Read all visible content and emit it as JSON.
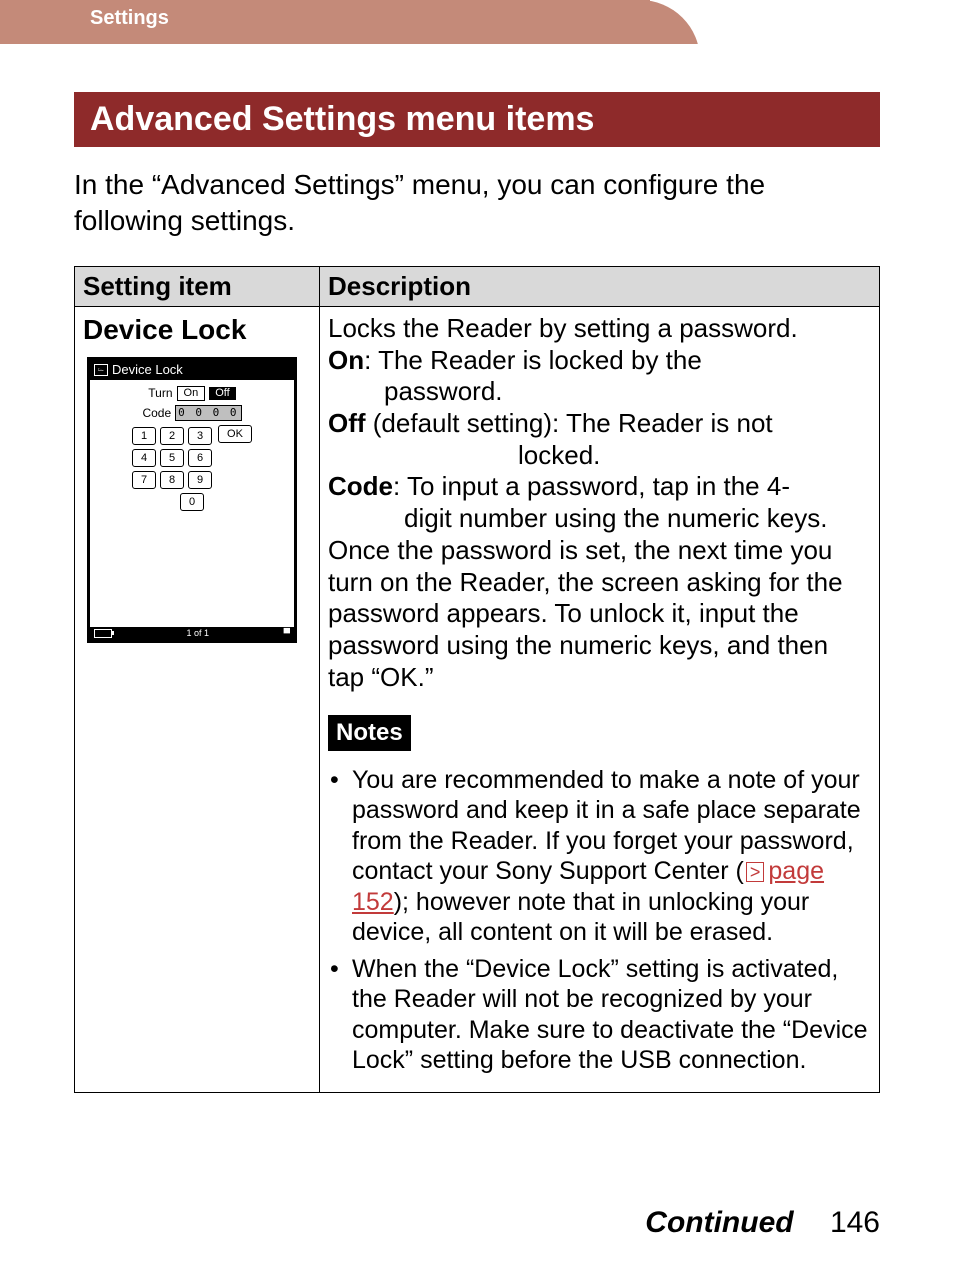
{
  "header": {
    "section_label": "Settings"
  },
  "banner": {
    "title": "Advanced Settings menu items"
  },
  "intro": "In the “Advanced Settings” menu, you can configure the following settings.",
  "table": {
    "headers": {
      "col1": "Setting item",
      "col2": "Description"
    },
    "row": {
      "setting_name": "Device Lock",
      "mini": {
        "title": "Device Lock",
        "turn_label": "Turn",
        "on_label": "On",
        "off_label": "Off",
        "code_label": "Code",
        "code_value": "0 0 0 0",
        "keys": {
          "k1": "1",
          "k2": "2",
          "k3": "3",
          "k4": "4",
          "k5": "5",
          "k6": "6",
          "k7": "7",
          "k8": "8",
          "k9": "9",
          "k0": "0"
        },
        "ok_label": "OK",
        "page_indicator": "1 of 1"
      },
      "desc": {
        "line1": "Locks the Reader by setting a password.",
        "on_label": "On",
        "on_text": ": The Reader is locked by the",
        "on_text2": "password.",
        "off_label": "Off",
        "off_text": " (default setting): The Reader is not",
        "off_text2": "locked.",
        "code_label": "Code",
        "code_text": ": To input a password, tap in the 4-",
        "code_text2": "digit number using the numeric keys.",
        "tail": "Once the password is set, the next time you turn on the Reader, the screen asking for the password appears. To unlock it, input the password using the numeric keys, and then tap “OK.”"
      },
      "notes_label": "Notes",
      "notes": {
        "n1a": "You are recommended to make a note of your password and keep it in a safe place separate from the Reader. If you forget your password, contact your Sony Support Center (",
        "n1_link": "page 152",
        "n1b": "); however note that in unlocking your device, all content on it will be erased.",
        "n2": "When the “Device Lock” setting is activated, the Reader will not be recognized by your computer. Make sure to deactivate the “Device Lock” setting before the USB connection."
      }
    }
  },
  "footer": {
    "continued": "Continued",
    "page_number": "146"
  }
}
